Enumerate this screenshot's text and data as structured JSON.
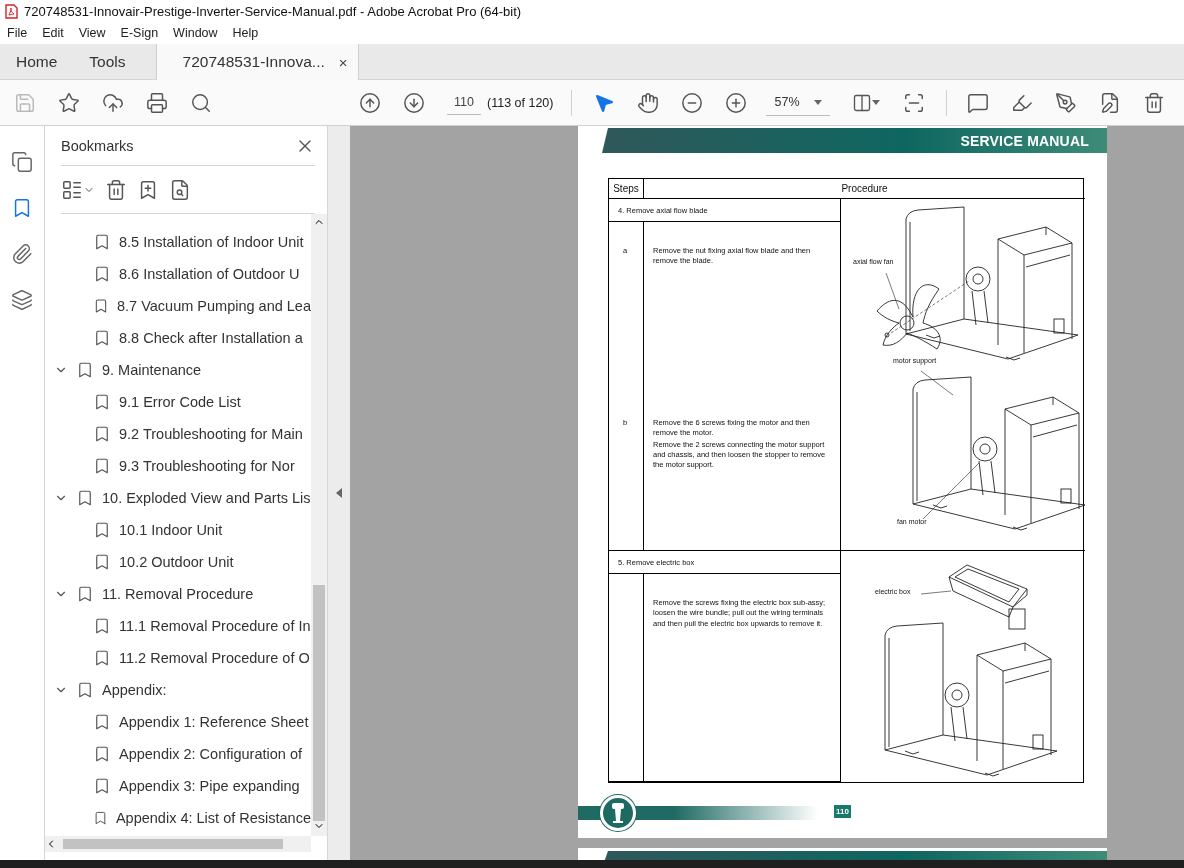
{
  "window": {
    "title": "720748531-Innovair-Prestige-Inverter-Service-Manual.pdf - Adobe Acrobat Pro (64-bit)"
  },
  "menu": [
    "File",
    "Edit",
    "View",
    "E-Sign",
    "Window",
    "Help"
  ],
  "tabs": [
    {
      "label": "Home",
      "selected": false
    },
    {
      "label": "Tools",
      "selected": false
    },
    {
      "label": "720748531-Innova...",
      "selected": true,
      "close": "×"
    }
  ],
  "toolbar": {
    "file_tools": [
      {
        "kind": "save",
        "disabled": true
      },
      {
        "kind": "star",
        "disabled": false
      },
      {
        "kind": "upload",
        "disabled": false
      },
      {
        "kind": "print",
        "disabled": false
      },
      {
        "kind": "find",
        "disabled": false
      }
    ],
    "page_nav": {
      "page": "110",
      "count": "(113 of 120)"
    },
    "view_tools": [
      {
        "kind": "select",
        "selected": true
      },
      {
        "kind": "hand",
        "selected": false
      }
    ],
    "zoom": {
      "value": "57%"
    },
    "edit_tools": [
      {
        "kind": "comment"
      },
      {
        "kind": "highlight"
      },
      {
        "kind": "sign"
      },
      {
        "kind": "edit"
      },
      {
        "kind": "delete"
      }
    ]
  },
  "rail": [
    {
      "kind": "pages",
      "selected": false
    },
    {
      "kind": "bookmarks",
      "selected": true
    },
    {
      "kind": "attachments",
      "selected": false
    },
    {
      "kind": "layers",
      "selected": false
    }
  ],
  "bookmarks": {
    "title": "Bookmarks",
    "continued_items": [
      {
        "label": "8.5 Installation of Indoor Unit"
      },
      {
        "label": "8.6 Installation of Outdoor U"
      },
      {
        "label": "8.7 Vacuum Pumping and Lea"
      },
      {
        "label": "8.8 Check after Installation a"
      }
    ],
    "items": [
      {
        "label": "9. Maintenance",
        "expanded": true,
        "children": [
          {
            "label": "9.1 Error Code List"
          },
          {
            "label": "9.2 Troubleshooting for Main"
          },
          {
            "label": "9.3 Troubleshooting for Nor"
          }
        ]
      },
      {
        "label": "10. Exploded View and Parts Lis",
        "expanded": true,
        "children": [
          {
            "label": "10.1 Indoor Unit"
          },
          {
            "label": "10.2 Outdoor Unit"
          }
        ]
      },
      {
        "label": "11. Removal Procedure",
        "expanded": true,
        "children": [
          {
            "label": "11.1 Removal Procedure of In"
          },
          {
            "label": "11.2 Removal Procedure of O"
          }
        ]
      },
      {
        "label": "Appendix:",
        "expanded": true,
        "children": [
          {
            "label": "Appendix 1: Reference Sheet"
          },
          {
            "label": "Appendix 2: Configuration of"
          },
          {
            "label": "Appendix 3: Pipe expanding"
          },
          {
            "label": "Appendix 4: List of Resistance"
          }
        ]
      }
    ]
  },
  "document": {
    "header": "SERVICE MANUAL",
    "table": {
      "columns": [
        "Steps",
        "Procedure"
      ],
      "sections": [
        {
          "title": "4. Remove axial flow blade",
          "steps": [
            {
              "step": "a",
              "paragraphs": [
                "Remove the nut fixing axial flow blade and then remove the blade."
              ]
            },
            {
              "step": "b",
              "paragraphs": [
                "Remove the 6 screws fixing the motor and then remove the motor.",
                "Remove the 2 screws connecting the motor support and chassis, and then loosen the stopper to remove the motor support."
              ]
            }
          ],
          "figure_labels": [
            "axial flow fan",
            "motor support",
            "fan motor"
          ]
        },
        {
          "title": "5. Remove electric box",
          "steps": [
            {
              "paragraphs": [
                "Remove the screws fixing the electric box sub-assy; loosen the wire bundle; pull out the wiring terminals and then pull the electric box upwards to remove it."
              ]
            }
          ],
          "figure_labels": [
            "electric box"
          ]
        }
      ]
    },
    "page_number": "110"
  }
}
